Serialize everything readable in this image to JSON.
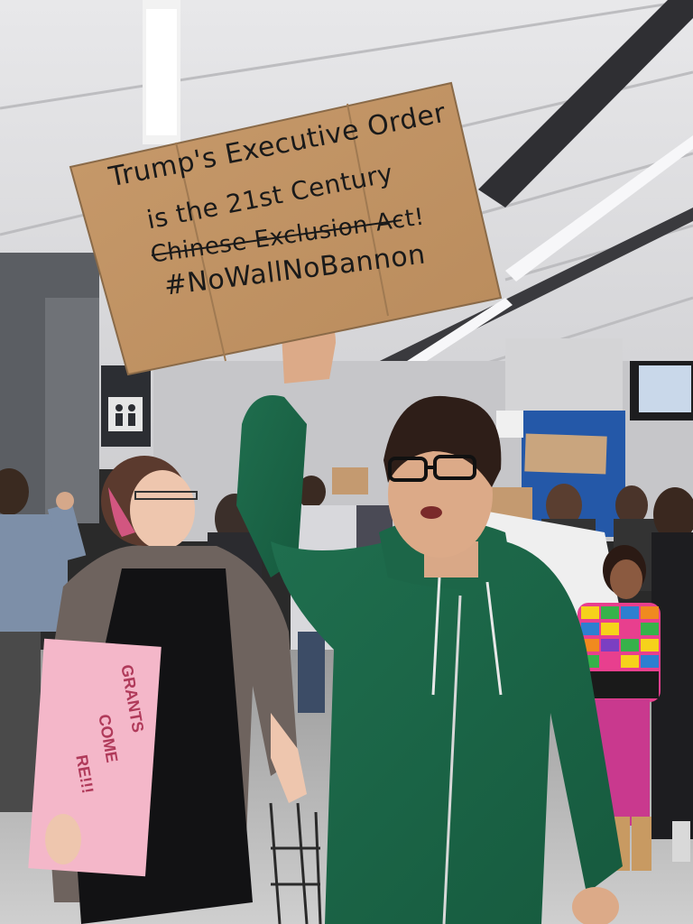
{
  "scene": {
    "description_label": "Airport protest photo",
    "main_sign": {
      "lines": [
        "Trump's Executive Order",
        "is the 21st Century",
        "Chinese Exclusion Act!",
        "#NoWallNoBannon"
      ]
    },
    "pink_sign": {
      "lines": [
        "GRANTS",
        "COME",
        "RE!!!"
      ]
    }
  }
}
